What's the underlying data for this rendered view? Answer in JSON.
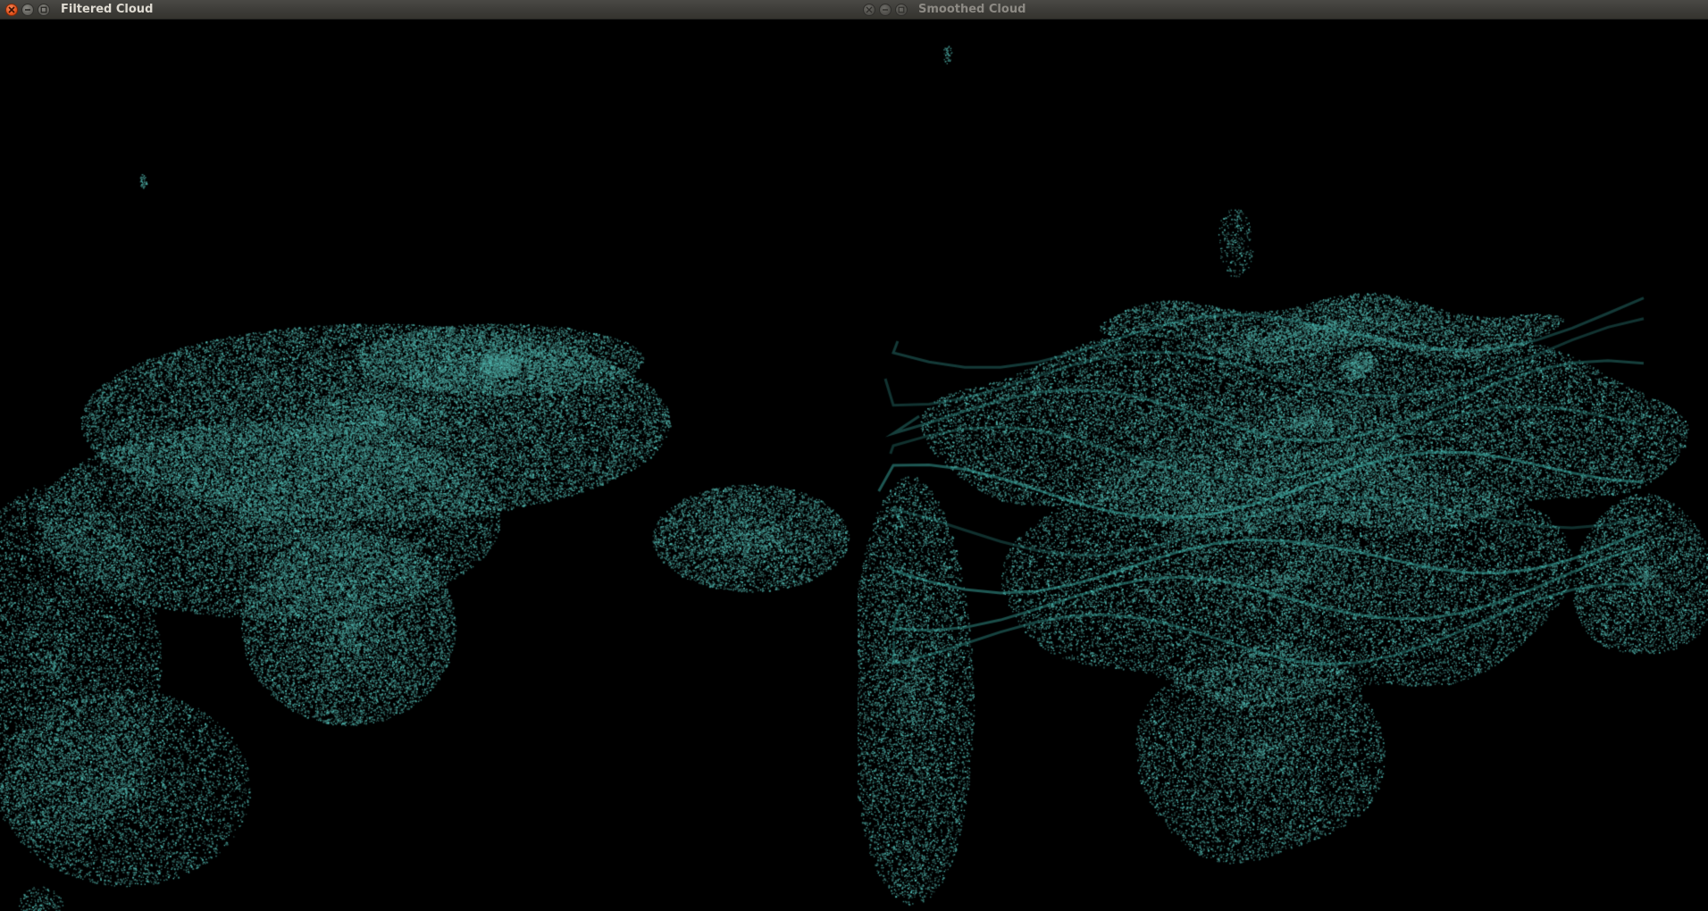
{
  "windows": [
    {
      "title": "Filtered Cloud",
      "active": true,
      "point_color": "#3fb5ad"
    },
    {
      "title": "Smoothed Cloud",
      "active": false,
      "point_color": "#3fb5ad"
    }
  ],
  "colors": {
    "background": "#000000",
    "titlebar": "#3c3b37",
    "close_button": "#e2531d"
  }
}
